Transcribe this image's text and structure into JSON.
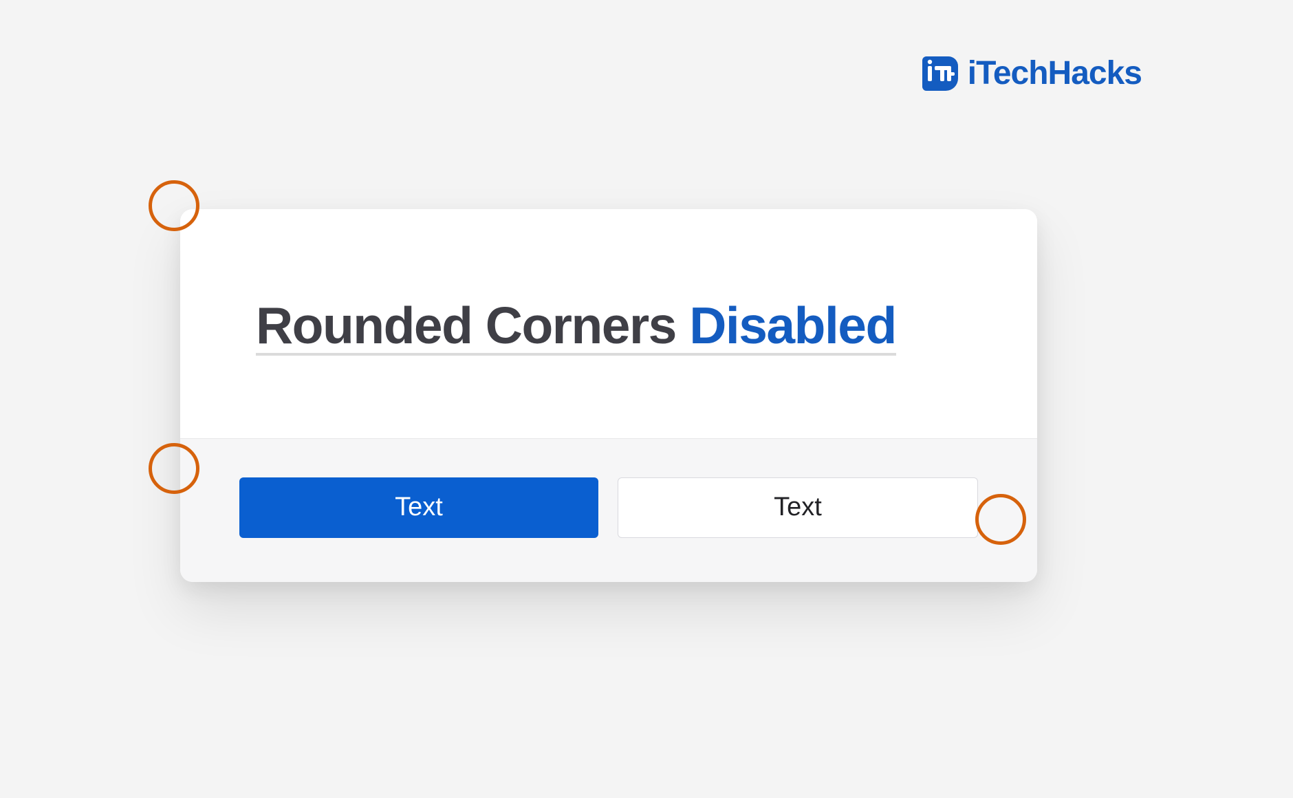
{
  "brand": {
    "name": "iTechHacks",
    "badge_letters": "iTH",
    "accent_color": "#145cc0"
  },
  "dialog": {
    "title_part1": "Rounded Corners ",
    "title_part2": "Disabled",
    "buttons": {
      "primary_label": "Text",
      "secondary_label": "Text"
    }
  },
  "annotations": {
    "marker_color": "#d6620c",
    "markers": [
      "top-left-corner",
      "left-divider-edge",
      "right-button-corner"
    ]
  }
}
